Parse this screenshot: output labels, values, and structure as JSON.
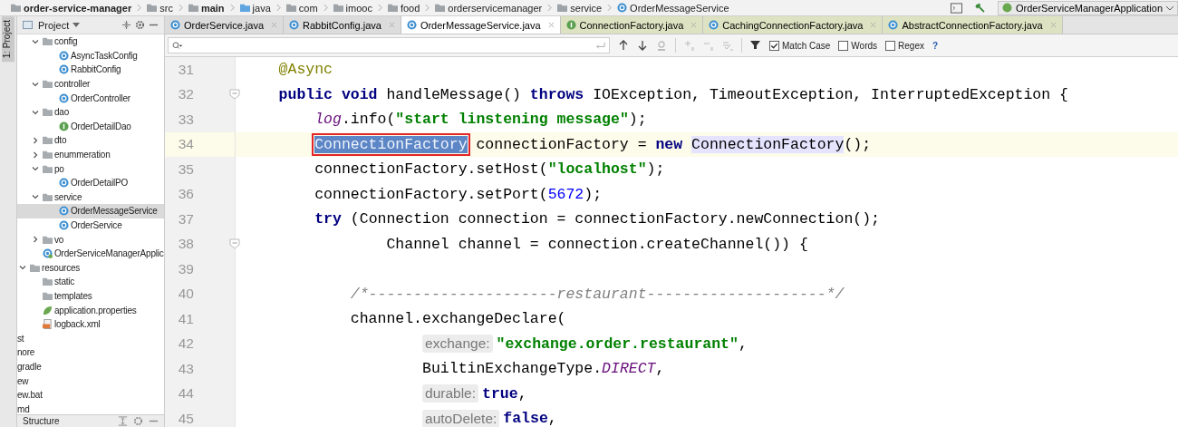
{
  "breadcrumb": [
    {
      "label": "order-service-manager",
      "kind": "module"
    },
    {
      "label": "src",
      "kind": "folder"
    },
    {
      "label": "main",
      "kind": "module"
    },
    {
      "label": "java",
      "kind": "source"
    },
    {
      "label": "com",
      "kind": "folder"
    },
    {
      "label": "imooc",
      "kind": "folder"
    },
    {
      "label": "food",
      "kind": "folder"
    },
    {
      "label": "orderservicemanager",
      "kind": "folder"
    },
    {
      "label": "service",
      "kind": "folder"
    },
    {
      "label": "OrderMessageService",
      "kind": "class"
    }
  ],
  "run_config": {
    "label": "OrderServiceManagerApplication"
  },
  "side_stripe": {
    "label": "1: Project"
  },
  "project": {
    "title": "Project",
    "tree": [
      {
        "children": [
          {
            "label": "config",
            "kind": "folder",
            "expanded": true,
            "selected": false,
            "children": [
              {
                "label": "AsyncTaskConfig",
                "kind": "class",
                "selected": false
              },
              {
                "label": "RabbitConfig",
                "kind": "class",
                "selected": false
              }
            ]
          },
          {
            "label": "controller",
            "kind": "folder",
            "expanded": true,
            "selected": false,
            "children": [
              {
                "label": "OrderController",
                "kind": "class",
                "selected": false
              }
            ]
          },
          {
            "label": "dao",
            "kind": "folder",
            "expanded": true,
            "selected": false,
            "children": [
              {
                "label": "OrderDetailDao",
                "kind": "interface",
                "selected": false
              }
            ]
          },
          {
            "label": "dto",
            "kind": "folder",
            "expanded": false,
            "selected": false
          },
          {
            "label": "enummeration",
            "kind": "folder",
            "expanded": false,
            "selected": false
          },
          {
            "label": "po",
            "kind": "folder",
            "expanded": true,
            "selected": false,
            "children": [
              {
                "label": "OrderDetailPO",
                "kind": "class",
                "selected": false
              }
            ]
          },
          {
            "label": "service",
            "kind": "folder",
            "expanded": true,
            "selected": false,
            "children": [
              {
                "label": "OrderMessageService",
                "kind": "class",
                "selected": true
              },
              {
                "label": "OrderService",
                "kind": "class",
                "selected": false
              }
            ]
          },
          {
            "label": "vo",
            "kind": "folder",
            "expanded": false,
            "selected": false
          },
          {
            "label": "OrderServiceManagerApplic",
            "kind": "spring",
            "selected": false
          }
        ]
      },
      {
        "label": "resources",
        "kind": "folder",
        "expanded": true,
        "selected": false,
        "children": [
          {
            "label": "static",
            "kind": "folder",
            "selected": false
          },
          {
            "label": "templates",
            "kind": "folder",
            "selected": false
          },
          {
            "label": "application.properties",
            "kind": "properties",
            "selected": false
          },
          {
            "label": "logback.xml",
            "kind": "xml",
            "selected": false
          }
        ]
      },
      {
        "label": "st",
        "kind": "text",
        "selected": false
      },
      {
        "label": "nore",
        "kind": "text",
        "selected": false
      },
      {
        "label": "gradle",
        "kind": "text",
        "selected": false
      },
      {
        "label": "ew",
        "kind": "text",
        "selected": false
      },
      {
        "label": "ew.bat",
        "kind": "text",
        "selected": false
      },
      {
        "label": "md",
        "kind": "text",
        "selected": false
      }
    ]
  },
  "structure": {
    "title": "Structure"
  },
  "tabs": [
    {
      "label": "OrderService.java",
      "kind": "class",
      "selected": false,
      "library": false
    },
    {
      "label": "RabbitConfig.java",
      "kind": "class",
      "selected": false,
      "library": false
    },
    {
      "label": "OrderMessageService.java",
      "kind": "class",
      "selected": true,
      "library": false
    },
    {
      "label": "ConnectionFactory.java",
      "kind": "interface",
      "selected": false,
      "library": true
    },
    {
      "label": "CachingConnectionFactory.java",
      "kind": "class",
      "selected": false,
      "library": true
    },
    {
      "label": "AbstractConnectionFactory.java",
      "kind": "class",
      "selected": false,
      "library": true
    }
  ],
  "search": {
    "options": [
      {
        "label": "Match Case",
        "checked": true
      },
      {
        "label": "Words",
        "checked": false
      },
      {
        "label": "Regex",
        "checked": false
      }
    ],
    "help": "?"
  },
  "code": [
    {
      "number": "31",
      "current": false,
      "fold": false,
      "continuation": false,
      "tokens": [
        {
          "kind": "annotation",
          "text": "@Async"
        }
      ]
    },
    {
      "number": "32",
      "current": false,
      "fold": true,
      "continuation": false,
      "tokens": [
        {
          "kind": "keyword",
          "text": "public void"
        },
        {
          "kind": "plain",
          "text": " handleMessage() "
        },
        {
          "kind": "keyword",
          "text": "throws"
        },
        {
          "kind": "plain",
          "text": " IOException, TimeoutException, InterruptedException {"
        }
      ],
      "children": [
        {
          "number": "33",
          "current": false,
          "fold": false,
          "continuation": false,
          "tokens": [
            {
              "kind": "static",
              "text": "log"
            },
            {
              "kind": "plain",
              "text": ".info("
            },
            {
              "kind": "string",
              "text": "\"start linstening message\""
            },
            {
              "kind": "plain",
              "text": ");"
            }
          ]
        },
        {
          "number": "34",
          "current": true,
          "fold": false,
          "continuation": false,
          "tokens": [
            {
              "kind": "selection",
              "text": "ConnectionFactory"
            },
            {
              "kind": "plain",
              "text": " connectionFactory = "
            },
            {
              "kind": "keyword",
              "text": "new"
            },
            {
              "kind": "usage",
              "text": "ConnectionFactory"
            },
            {
              "kind": "plain",
              "text": "();"
            }
          ]
        },
        {
          "number": "35",
          "current": false,
          "fold": false,
          "continuation": false,
          "tokens": [
            {
              "kind": "plain",
              "text": "connectionFactory.setHost("
            },
            {
              "kind": "string",
              "text": "\"localhost\""
            },
            {
              "kind": "plain",
              "text": ");"
            }
          ]
        },
        {
          "number": "36",
          "current": false,
          "fold": false,
          "continuation": false,
          "tokens": [
            {
              "kind": "plain",
              "text": "connectionFactory.setPort("
            },
            {
              "kind": "number",
              "text": "5672"
            },
            {
              "kind": "plain",
              "text": ");"
            }
          ]
        },
        {
          "number": "37",
          "current": false,
          "fold": false,
          "continuation": false,
          "tokens": [
            {
              "kind": "keyword",
              "text": "try"
            },
            {
              "kind": "plain",
              "text": " (Connection connection = connectionFactory.newConnection();"
            }
          ],
          "children": [
            {
              "number": "38",
              "current": false,
              "fold": true,
              "continuation": true,
              "tokens": [
                {
                  "kind": "plain",
                  "text": "Channel channel = connection.createChannel()) {"
                }
              ]
            },
            {
              "number": "39",
              "current": false,
              "fold": false
            },
            {
              "number": "40",
              "current": false,
              "fold": false,
              "continuation": false,
              "tokens": [
                {
                  "kind": "comment",
                  "text": "/*---------------------restaurant--------------------*/"
                }
              ]
            },
            {
              "number": "41",
              "current": false,
              "fold": false,
              "continuation": false,
              "tokens": [
                {
                  "kind": "plain",
                  "text": "channel.exchangeDeclare("
                }
              ],
              "children": [
                {
                  "number": "42",
                  "current": false,
                  "fold": false,
                  "continuation": true,
                  "tokens": [
                    {
                      "kind": "hint",
                      "text": "exchange:"
                    },
                    {
                      "kind": "string",
                      "text": "\"exchange.order.restaurant\""
                    },
                    {
                      "kind": "plain",
                      "text": ","
                    }
                  ]
                },
                {
                  "number": "43",
                  "current": false,
                  "fold": false,
                  "continuation": true,
                  "tokens": [
                    {
                      "kind": "plain",
                      "text": "BuiltinExchangeType."
                    },
                    {
                      "kind": "static",
                      "text": "DIRECT"
                    },
                    {
                      "kind": "plain",
                      "text": ","
                    }
                  ]
                },
                {
                  "number": "44",
                  "current": false,
                  "fold": false,
                  "continuation": true,
                  "tokens": [
                    {
                      "kind": "hint",
                      "text": "durable:"
                    },
                    {
                      "kind": "keyword",
                      "text": "true"
                    },
                    {
                      "kind": "plain",
                      "text": ","
                    }
                  ]
                },
                {
                  "number": "45",
                  "current": false,
                  "fold": false,
                  "continuation": true,
                  "tokens": [
                    {
                      "kind": "hint",
                      "text": "autoDelete:"
                    },
                    {
                      "kind": "keyword",
                      "text": "false"
                    },
                    {
                      "kind": "plain",
                      "text": ","
                    }
                  ]
                }
              ]
            }
          ]
        }
      ]
    }
  ]
}
